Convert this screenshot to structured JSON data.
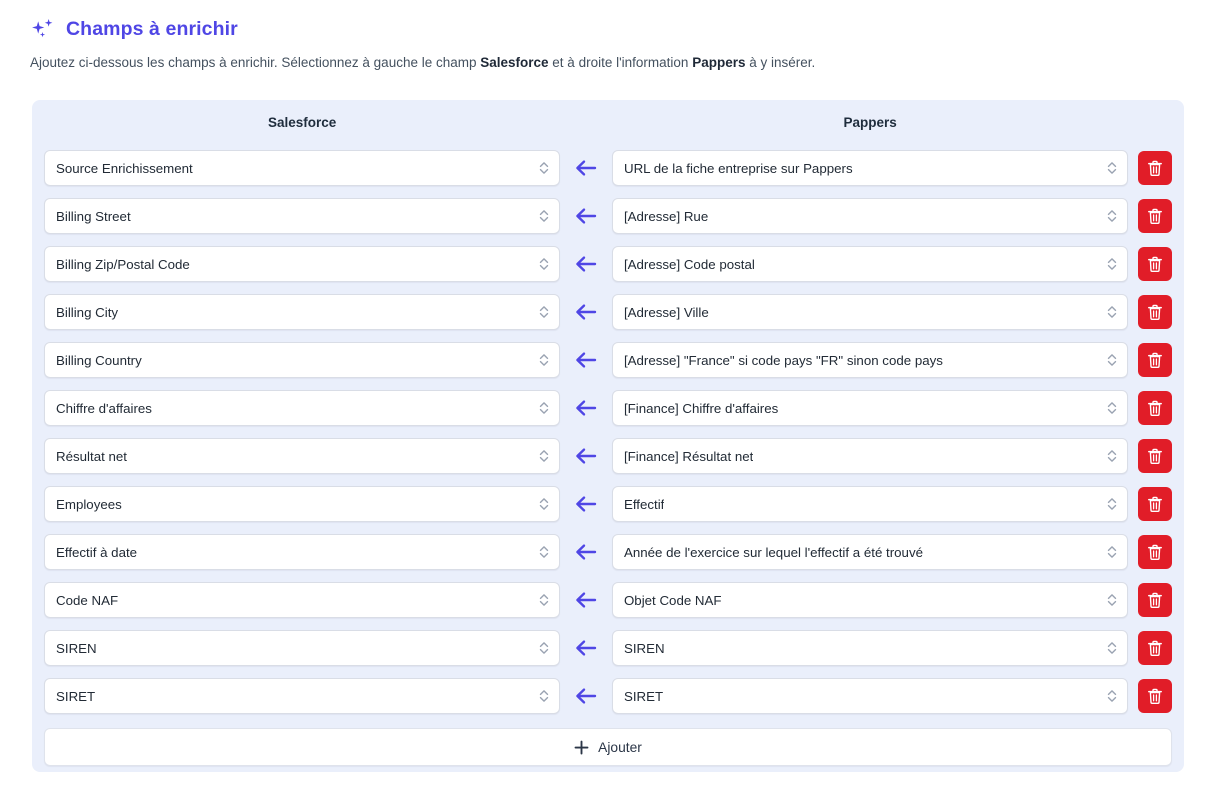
{
  "header": {
    "icon": "sparkles-icon",
    "title": "Champs à enrichir",
    "subtitle_part1": "Ajoutez ci-dessous les champs à enrichir. Sélectionnez à gauche le champ ",
    "subtitle_bold1": "Salesforce",
    "subtitle_part2": " et à droite l'information ",
    "subtitle_bold2": "Pappers",
    "subtitle_part3": " à y insérer."
  },
  "colors": {
    "accent": "#4f46e5",
    "panel_background": "#eaeffb",
    "delete_red": "#e11d28",
    "page_background": "#ffffff",
    "field_border": "#d9dde6"
  },
  "columns": {
    "left_label": "Salesforce",
    "right_label": "Pappers"
  },
  "mapping_rows": [
    {
      "salesforce": "Source Enrichissement",
      "arrow": "arrow-left-icon",
      "pappers": "URL de la fiche entreprise sur Pappers",
      "delete": "trash-icon"
    },
    {
      "salesforce": "Billing Street",
      "arrow": "arrow-left-icon",
      "pappers": "[Adresse] Rue",
      "delete": "trash-icon"
    },
    {
      "salesforce": "Billing Zip/Postal Code",
      "arrow": "arrow-left-icon",
      "pappers": "[Adresse] Code postal",
      "delete": "trash-icon"
    },
    {
      "salesforce": "Billing City",
      "arrow": "arrow-left-icon",
      "pappers": "[Adresse] Ville",
      "delete": "trash-icon"
    },
    {
      "salesforce": "Billing Country",
      "arrow": "arrow-left-icon",
      "pappers": "[Adresse] \"France\" si code pays \"FR\" sinon code pays",
      "delete": "trash-icon"
    },
    {
      "salesforce": "Chiffre d'affaires",
      "arrow": "arrow-left-icon",
      "pappers": "[Finance] Chiffre d'affaires",
      "delete": "trash-icon"
    },
    {
      "salesforce": "Résultat net",
      "arrow": "arrow-left-icon",
      "pappers": "[Finance] Résultat net",
      "delete": "trash-icon"
    },
    {
      "salesforce": "Employees",
      "arrow": "arrow-left-icon",
      "pappers": "Effectif",
      "delete": "trash-icon"
    },
    {
      "salesforce": "Effectif à date",
      "arrow": "arrow-left-icon",
      "pappers": "Année de l'exercice sur lequel l'effectif a été trouvé",
      "delete": "trash-icon"
    },
    {
      "salesforce": "Code NAF",
      "arrow": "arrow-left-icon",
      "pappers": "Objet Code NAF",
      "delete": "trash-icon"
    },
    {
      "salesforce": "SIREN",
      "arrow": "arrow-left-icon",
      "pappers": "SIREN",
      "delete": "trash-icon"
    },
    {
      "salesforce": "SIRET",
      "arrow": "arrow-left-icon",
      "pappers": "SIRET",
      "delete": "trash-icon"
    }
  ],
  "add_button": {
    "icon": "plus-icon",
    "label": "Ajouter"
  }
}
